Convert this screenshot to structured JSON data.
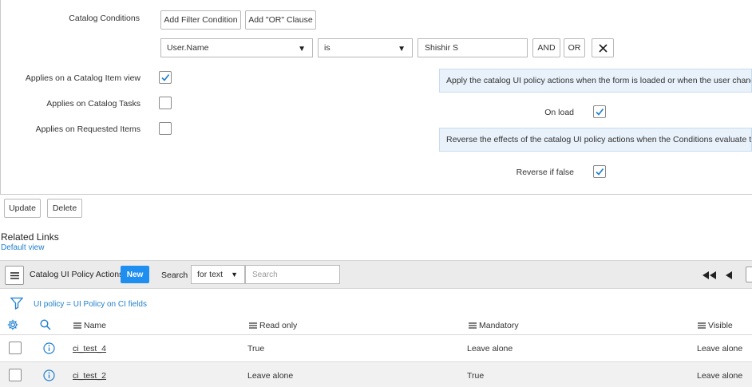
{
  "form": {
    "catalog_conditions_label": "Catalog Conditions",
    "add_filter_condition": "Add Filter Condition",
    "add_or_clause": "Add \"OR\" Clause",
    "condition": {
      "field": "User.Name",
      "operator": "is",
      "value": "Shishir S",
      "and_label": "AND",
      "or_label": "OR"
    },
    "applies_catalog_item_view": {
      "label": "Applies on a Catalog Item view",
      "checked": true
    },
    "applies_catalog_tasks": {
      "label": "Applies on Catalog Tasks",
      "checked": false
    },
    "applies_requested_items": {
      "label": "Applies on Requested Items",
      "checked": false
    },
    "onload_info": "Apply the catalog UI policy actions when the form is loaded or when the user changes values",
    "on_load": {
      "label": "On load",
      "checked": true
    },
    "reverse_info": "Reverse the effects of the catalog UI policy actions when the Conditions evaluate to false",
    "reverse_if_false": {
      "label": "Reverse if false",
      "checked": true
    }
  },
  "actions": {
    "update": "Update",
    "delete": "Delete"
  },
  "related": {
    "title": "Related Links",
    "default_view": "Default view"
  },
  "list": {
    "title": "Catalog UI Policy Actions",
    "new_label": "New",
    "search_label": "Search",
    "search_select": "for text",
    "search_placeholder": "Search",
    "filter_text": "UI policy = UI Policy on CI fields",
    "columns": [
      "Name",
      "Read only",
      "Mandatory",
      "Visible"
    ],
    "rows": [
      {
        "name": "ci_test_4",
        "read_only": "True",
        "mandatory": "Leave alone",
        "visible": "Leave alone"
      },
      {
        "name": "ci_test_2",
        "read_only": "Leave alone",
        "mandatory": "True",
        "visible": "Leave alone"
      }
    ]
  },
  "colors": {
    "accent": "#1f8ef1",
    "info_bg": "#e9f2fb",
    "link": "#1f7fd0"
  }
}
